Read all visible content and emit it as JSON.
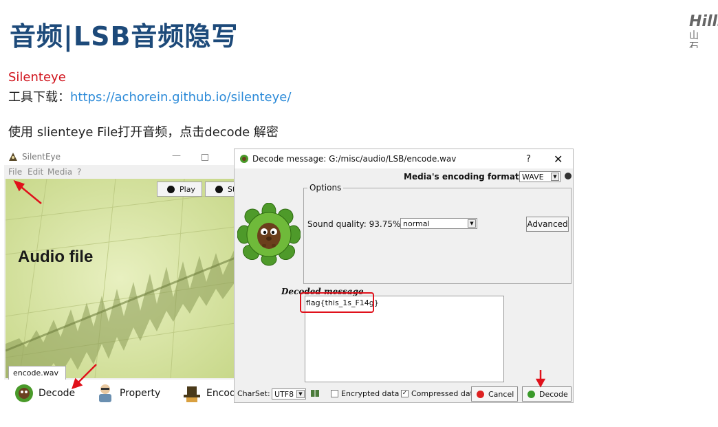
{
  "slide": {
    "title": "音频|LSB音频隐写",
    "logo_text": "Hills",
    "logo_subtext": "山 石",
    "tool_name": "Silenteye",
    "download_prefix": "工具下载：",
    "download_url": "https://achorein.github.io/silenteye/",
    "instruction": "使用 slienteye File打开音频，点击decode 解密"
  },
  "main_window": {
    "title": "SilentEye",
    "menu": [
      "File",
      "Edit",
      "Media",
      "?"
    ],
    "play_label": "Play",
    "stop_label": "Sto",
    "canvas_label": "Audio file",
    "file_tab": "encode.wav",
    "toolbar": [
      {
        "label": "Decode",
        "icon": "decode-mascot-icon"
      },
      {
        "label": "Property",
        "icon": "property-person-icon"
      },
      {
        "label": "Encod",
        "icon": "encode-hat-icon"
      }
    ]
  },
  "decode_dialog": {
    "title": "Decode message: G:/misc/audio/LSB/encode.wav",
    "help": "?",
    "close": "✕",
    "format_label": "Media's encoding format :",
    "format_value": "WAVE",
    "options_legend": "Options",
    "sound_quality_label": "Sound quality:",
    "sound_quality_value": "93.75%",
    "quality_select": "normal",
    "advanced_label": "Advanced",
    "decoded_label": "Decoded message",
    "decoded_text": "flag{this_1s_F14g}",
    "charset_label": "CharSet:",
    "charset_value": "UTF8",
    "encrypted_label": "Encrypted data",
    "encrypted_checked": false,
    "compressed_label": "Compressed dat",
    "compressed_checked": true,
    "cancel_label": "Cancel",
    "decode_label": "Decode"
  },
  "colors": {
    "title": "#1d4a7a",
    "tool_name": "#d0121b",
    "link": "#2b8ad8",
    "annotation": "#e0111b",
    "canvas_bg": "#dce8a6"
  }
}
